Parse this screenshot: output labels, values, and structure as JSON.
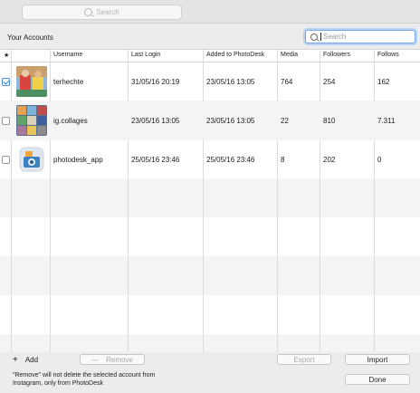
{
  "toolbar": {
    "search_placeholder": "Search"
  },
  "header": {
    "title": "Your Accounts",
    "search_placeholder": "Search"
  },
  "table": {
    "columns": [
      "★",
      "Username",
      "Last Login",
      "Added to PhotoDesk",
      "Media",
      "Followers",
      "Follows"
    ],
    "rows": [
      {
        "checked": true,
        "username": "terhechte",
        "last_login": "31/05/16 20:19",
        "added": "23/05/16 13:05",
        "media": "764",
        "followers": "254",
        "follows": "162"
      },
      {
        "checked": false,
        "username": "ig.collages",
        "last_login": "23/05/16 13:05",
        "added": "23/05/16 13:05",
        "media": "22",
        "followers": "810",
        "follows": "7.311"
      },
      {
        "checked": false,
        "username": "photodesk_app",
        "last_login": "25/05/16 23:46",
        "added": "25/05/16 23:46",
        "media": "8",
        "followers": "202",
        "follows": "0"
      }
    ]
  },
  "buttons": {
    "add": "Add",
    "add_symbol": "+",
    "remove": "Remove",
    "remove_symbol": "—",
    "export": "Export",
    "import": "Import",
    "done": "Done"
  },
  "note": "\"Remove\" will not delete the selected account from Instagram, only from PhotoDesk"
}
